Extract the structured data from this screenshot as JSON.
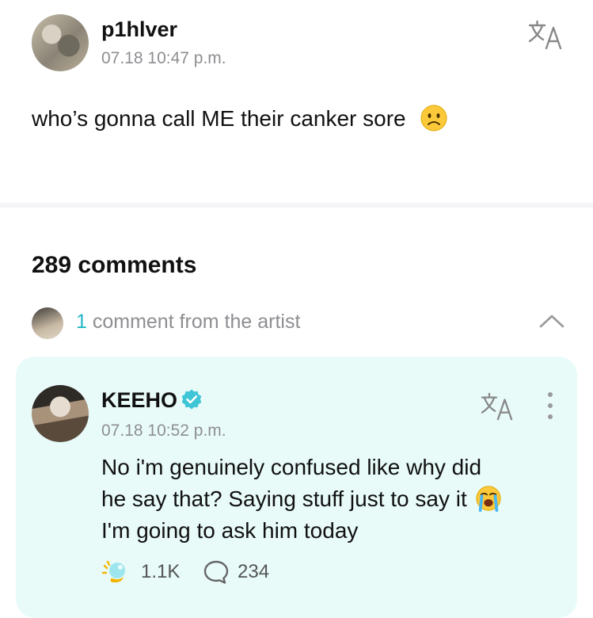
{
  "post": {
    "username": "p1hlver",
    "timestamp": "07.18 10:47 p.m.",
    "text": "who’s gonna call ME their canker sore",
    "emoji": "slightly-frowning-face"
  },
  "comments": {
    "count_label": "289 comments",
    "artist_count": "1",
    "artist_label": " comment from the artist"
  },
  "artist_comment": {
    "username": "KEEHO",
    "verified": true,
    "timestamp": "07.18 10:52 p.m.",
    "lines": [
      "No i'm genuinely confused like why did",
      "he say that? Saying stuff just to say it",
      "I'm going to ask him today"
    ],
    "emoji": "loudly-crying-face",
    "likes": "1.1K",
    "replies": "234"
  },
  "colors": {
    "accent": "#22b6c4",
    "card_bg": "#e8fbf9",
    "muted": "#8e8e93",
    "verified": "#3ec5d6"
  }
}
